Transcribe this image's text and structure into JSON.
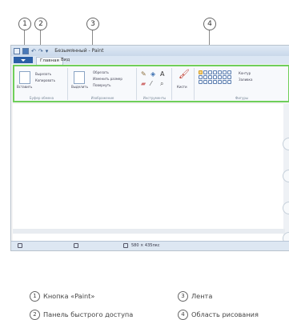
{
  "callouts": [
    "1",
    "2",
    "3",
    "4"
  ],
  "window": {
    "title": "Безымянный - Paint",
    "tabs": [
      "Главная",
      "Вид"
    ]
  },
  "ribbon": {
    "groups": [
      {
        "label": "Буфер обмена",
        "items": [
          "Вставить",
          "Вырезать",
          "Копировать"
        ]
      },
      {
        "label": "Изображение",
        "items": [
          "Выделить",
          "Обрезать",
          "Изменить размер",
          "Повернуть"
        ]
      },
      {
        "label": "Инструменты",
        "items": []
      },
      {
        "label": "Кисти",
        "items": [
          "Кисти"
        ]
      },
      {
        "label": "Фигуры",
        "items": [
          "Контур",
          "Заливка"
        ]
      }
    ]
  },
  "status": {
    "size_text": "580 × 435пкс"
  },
  "legend": [
    {
      "num": "1",
      "text": "Кнопка «Paint»"
    },
    {
      "num": "2",
      "text": "Панель быстрого доступа"
    },
    {
      "num": "3",
      "text": "Лента"
    },
    {
      "num": "4",
      "text": "Область рисования"
    }
  ],
  "colors": {
    "ribbon_highlight": "#6fcf5a",
    "paint_button": "#2a5fa6"
  }
}
